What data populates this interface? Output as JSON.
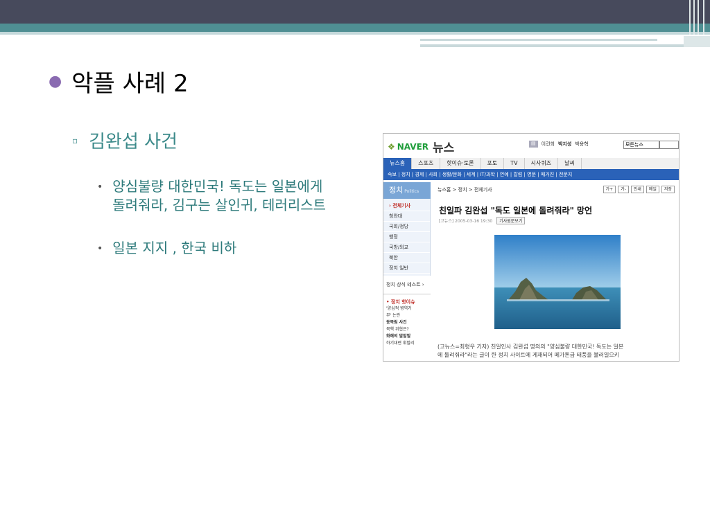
{
  "slide": {
    "title": "악플 사례 2",
    "subtitle": "김완섭 사건",
    "bullets": [
      {
        "line1": "양심불량 대한민국! 독도는 일본에게",
        "line2": "돌려줘라, 김구는 살인귀, 테러리스트"
      },
      {
        "line1": "일본 지지 , 한국 비하"
      }
    ],
    "colors": {
      "topbar": "#474a5c",
      "teal": "#4f8f93",
      "subtitle": "#3c8a8a",
      "bullet_dot": "#8a6bb1"
    }
  },
  "screenshot": {
    "logo": "NAVER",
    "news": "뉴스",
    "top_links": [
      "이건희",
      "박지성",
      "박용혁"
    ],
    "top_select": "모든뉴스",
    "tabs": [
      "뉴스홈",
      "스포츠",
      "핫이슈·토론",
      "포토",
      "TV",
      "시사퀴즈",
      "날씨"
    ],
    "subnav": "속보 | 정치 | 경제 | 사회 | 생활/문화 | 세계 | IT/과학 | 연예 | 칼럼 | 영문 | 매거진 | 전문지",
    "side": {
      "category": "정치",
      "category_en": "Politics",
      "items": [
        "전체기사",
        "청와대",
        "국회/정당",
        "행정",
        "국방/외교",
        "북한",
        "정치 일반"
      ],
      "test": "정치 상식 테스트 ›",
      "hot_title": "정치 핫이슈",
      "hot_items": [
        "'양심적 병역거",
        "부' 논란",
        "동북림 사건",
        "북핵 위협은?",
        "화해의 말말말",
        "하기대련 휘발리"
      ]
    },
    "crumb": "뉴스홈 > 정치 > 전체기사",
    "tools": [
      "가+",
      "가-",
      "인쇄",
      "메일",
      "저장"
    ],
    "headline": "친일파 김완섭 \"독도 일본에 돌려줘라\" 망언",
    "meta_date": "[고뉴스] 2005-03-16 19:30",
    "meta_btn": "기사원문보기",
    "body1": "(고뉴스=최형우 기자) 친일인사 김완섭 명의의 \"양심불량 대한민국! 독도는 일본",
    "body2": "에 돌려줘라\"라는 글이 한 정치 사이트에 게재되어 메가톤급 태풍을 불러일으키"
  }
}
